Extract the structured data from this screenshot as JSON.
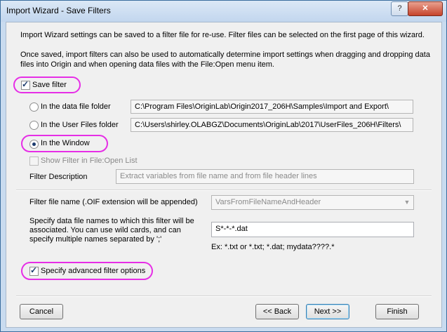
{
  "window": {
    "title": "Import Wizard - Save Filters",
    "help_label": "?",
    "close_label": "✕"
  },
  "intro": {
    "line1": "Import Wizard settings can be saved to a filter file for re-use. Filter files can be selected on the first page of this wizard.",
    "line2": "Once saved, import filters can also be used to automatically determine import settings when dragging and dropping data files into Origin and when opening data files with the File:Open menu item."
  },
  "save_filter": {
    "label": "Save filter",
    "checked": true
  },
  "locations": [
    {
      "label": "In the data file folder",
      "path": "C:\\Program Files\\OriginLab\\Origin2017_206H\\Samples\\Import and Export\\",
      "selected": false
    },
    {
      "label": "In the User Files folder",
      "path": "C:\\Users\\shirley.OLABGZ\\Documents\\OriginLab\\2017\\UserFiles_206H\\Filters\\",
      "selected": false
    },
    {
      "label": "In the Window",
      "selected": true
    }
  ],
  "show_filter": {
    "label": "Show Filter in File:Open List",
    "checked": false,
    "enabled": false
  },
  "filter_description": {
    "label": "Filter Description",
    "value": "Extract variables from file name and from file header lines"
  },
  "filter_file_name": {
    "label": "Filter file name (.OIF extension will be appended)",
    "value": "VarsFromFileNameAndHeader",
    "arrow": "▼"
  },
  "data_file_names": {
    "label": "Specify data file names to which this filter will be associated.  You can use wild cards, and can specify multiple names separated by ';'",
    "value": "S*-*-*.dat",
    "example": "Ex: *.txt or *.txt; *.dat; mydata????.*"
  },
  "advanced": {
    "label": "Specify advanced filter options",
    "checked": true
  },
  "buttons": {
    "cancel": "Cancel",
    "back": "<< Back",
    "next": "Next >>",
    "finish": "Finish"
  },
  "colors": {
    "highlight": "#e62ee6",
    "title_bar": "#c9dbef",
    "close_button": "#c6442c"
  }
}
